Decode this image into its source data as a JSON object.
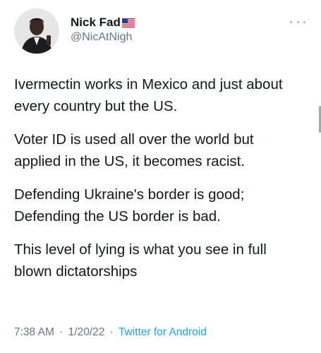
{
  "tweet": {
    "author": {
      "display_name": "Nick Fad",
      "handle": "@NicAtNigh",
      "flag_icon": "us-flag-icon"
    },
    "paragraphs": [
      "Ivermectin works in Mexico and just about every country but the US.",
      "Voter ID is used all over the world but applied in the US, it becomes racist.",
      "Defending Ukraine's border is good; Defending the US border is bad.",
      "This level of lying is what you see in full blown dictatorships"
    ],
    "meta": {
      "time": "7:38 AM",
      "separator": "·",
      "date": "1/20/22",
      "source": "Twitter for Android"
    }
  },
  "colors": {
    "text": "#14171a",
    "secondary": "#657786",
    "link": "#1da1f2"
  }
}
